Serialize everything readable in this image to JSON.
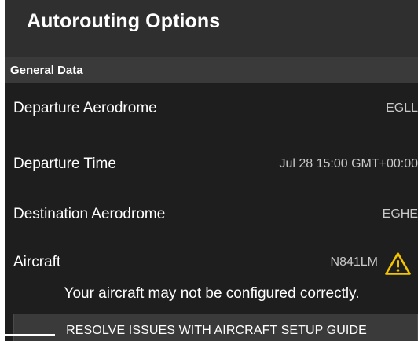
{
  "header": {
    "title": "Autorouting Options"
  },
  "section": {
    "title": "General Data"
  },
  "rows": [
    {
      "label": "Departure Aerodrome",
      "value": "EGLL"
    },
    {
      "label": "Departure Time",
      "value": "Jul 28 15:00 GMT+00:00"
    },
    {
      "label": "Destination Aerodrome",
      "value": "EGHE"
    },
    {
      "label": "Aircraft",
      "value": "N841LM",
      "icon": "warning-icon"
    }
  ],
  "warning": {
    "message": "Your aircraft may not be configured correctly."
  },
  "guide_button": {
    "label": "RESOLVE ISSUES WITH AIRCRAFT SETUP GUIDE"
  },
  "colors": {
    "background": "#1e1e1e",
    "header": "#2f2f2f",
    "section": "#3a3a3a",
    "value_text": "#c9c9c9",
    "warning_yellow": "#f2c500"
  }
}
